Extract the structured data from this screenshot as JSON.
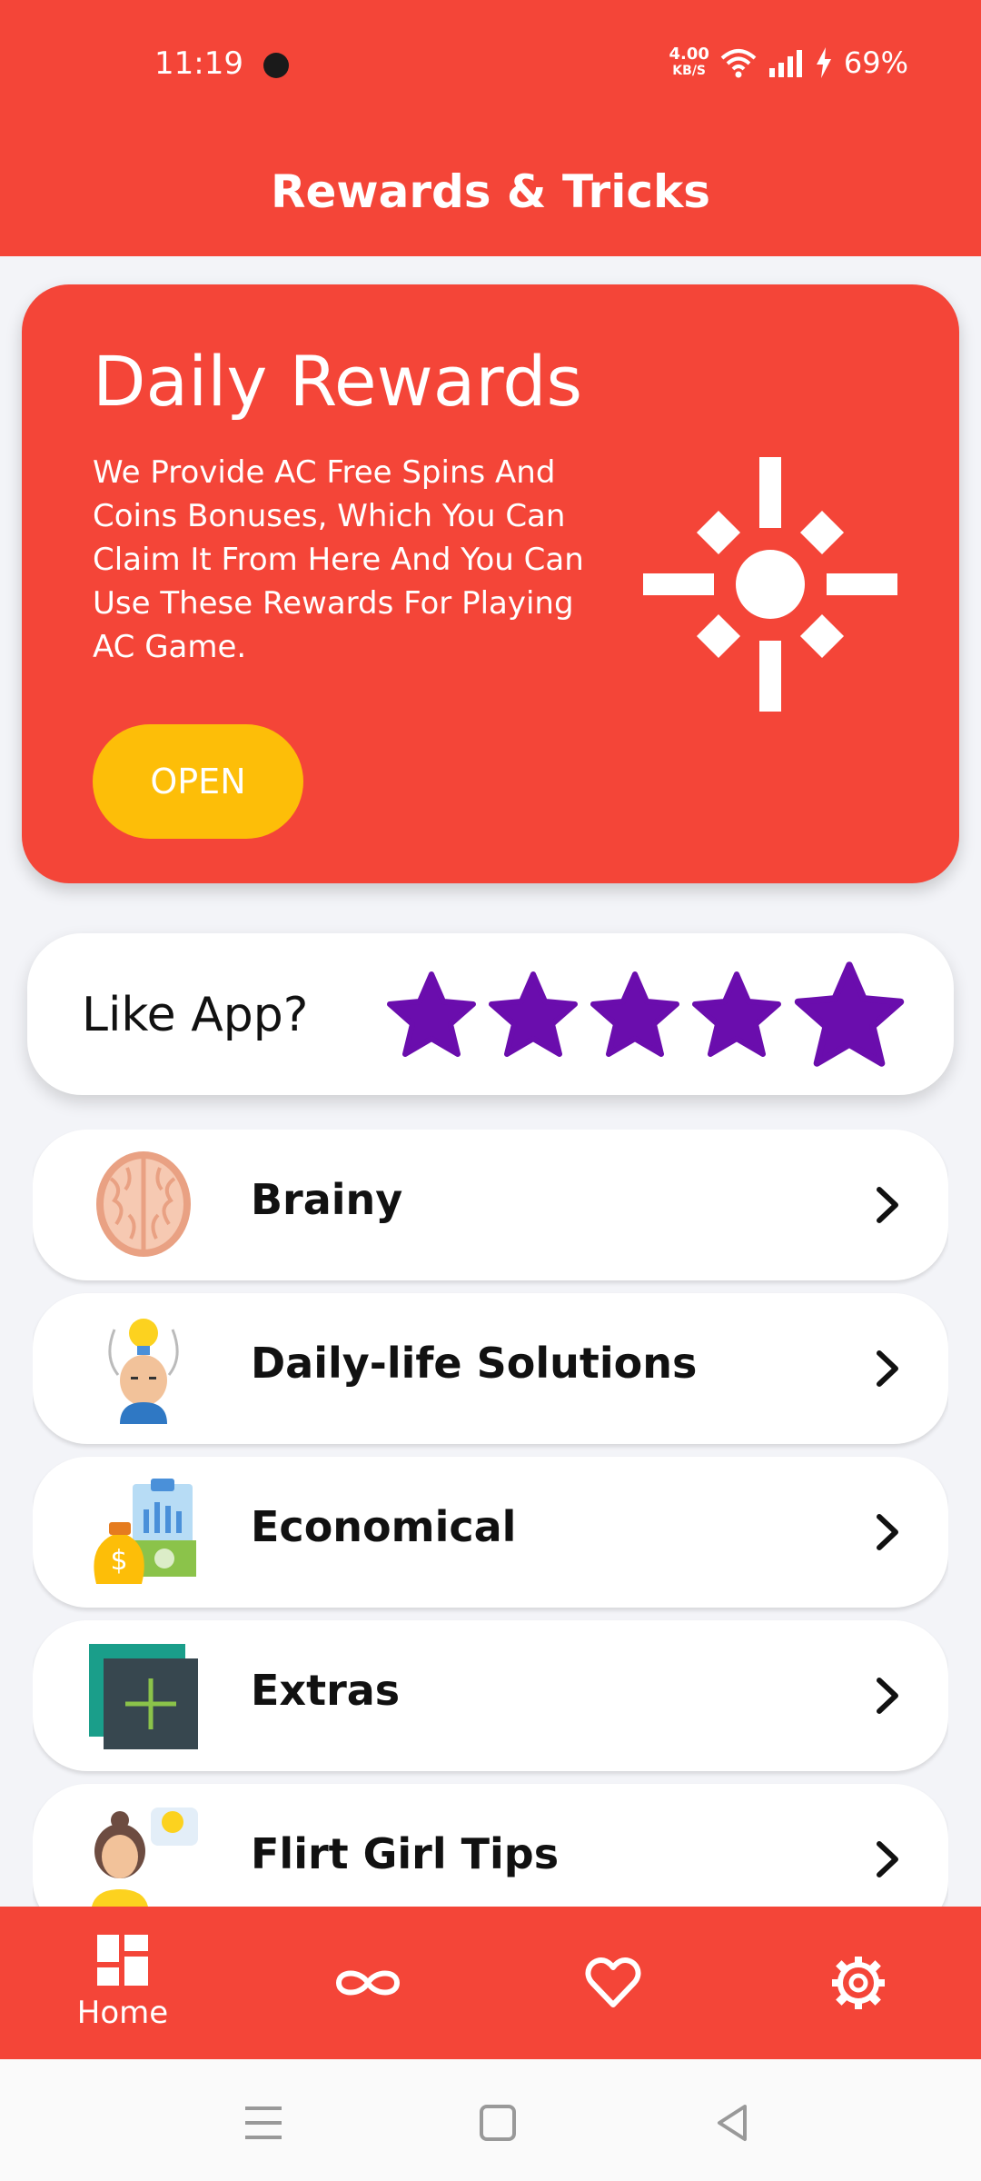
{
  "status_bar": {
    "time": "11:19",
    "net_speed_value": "4.00",
    "net_speed_unit": "KB/S",
    "battery": "69%"
  },
  "app_bar": {
    "title": "Rewards & Tricks"
  },
  "hero": {
    "title": "Daily Rewards",
    "description": "We Provide AC Free Spins And Coins Bonuses, Which You Can Claim It From Here And You Can Use These Rewards For Playing AC Game.",
    "button_label": "OPEN",
    "icon": "sun-icon"
  },
  "rating": {
    "label": "Like App?",
    "stars_total": 5,
    "star_color": "#6a0dad"
  },
  "list": {
    "items": [
      {
        "label": "Brainy",
        "icon": "brain-icon"
      },
      {
        "label": "Daily-life Solutions",
        "icon": "idea-person-icon"
      },
      {
        "label": "Economical",
        "icon": "money-bag-icon"
      },
      {
        "label": "Extras",
        "icon": "add-square-icon"
      },
      {
        "label": "Flirt Girl Tips",
        "icon": "girl-idea-icon"
      }
    ]
  },
  "bottom_nav": {
    "items": [
      {
        "label": "Home",
        "icon": "dashboard-icon",
        "active": true
      },
      {
        "label": "",
        "icon": "infinity-icon",
        "active": false
      },
      {
        "label": "",
        "icon": "heart-icon",
        "active": false
      },
      {
        "label": "",
        "icon": "gear-icon",
        "active": false
      }
    ]
  },
  "colors": {
    "primary": "#f44538",
    "button": "#fdbe08",
    "star": "#6a0dad"
  }
}
